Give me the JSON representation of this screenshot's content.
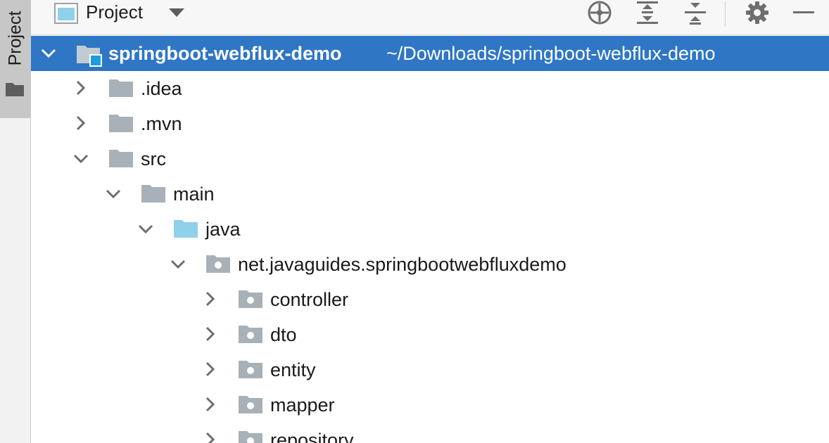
{
  "strip": {
    "label": "Project"
  },
  "header": {
    "title": "Project",
    "tools": [
      "locate-icon",
      "expand-all-icon",
      "collapse-all-icon",
      "gear-icon",
      "minimize-icon"
    ]
  },
  "tree": {
    "root": {
      "name": "springboot-webflux-demo",
      "path": "~/Downloads/springboot-webflux-demo"
    },
    "items": [
      {
        "label": ".idea"
      },
      {
        "label": ".mvn"
      },
      {
        "label": "src"
      },
      {
        "label": "main"
      },
      {
        "label": "java"
      },
      {
        "label": "net.javaguides.springbootwebfluxdemo"
      },
      {
        "label": "controller"
      },
      {
        "label": "dto"
      },
      {
        "label": "entity"
      },
      {
        "label": "mapper"
      },
      {
        "label": "repository"
      }
    ]
  },
  "colors": {
    "selection": "#2f76c5",
    "folder": "#a9b1b8",
    "source_folder": "#8fd0ea"
  }
}
